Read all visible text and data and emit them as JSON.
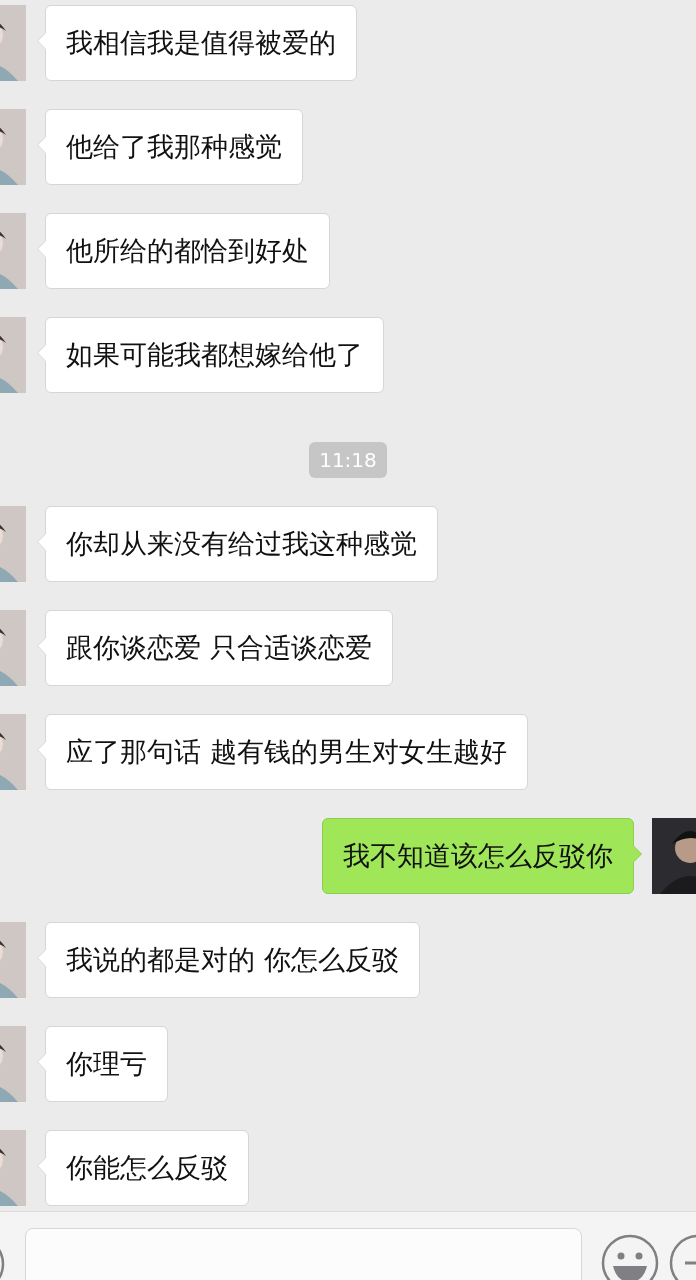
{
  "messages": [
    {
      "kind": "incoming",
      "text": "我相信我是值得被爱的"
    },
    {
      "kind": "incoming",
      "text": "他给了我那种感觉"
    },
    {
      "kind": "incoming",
      "text": "他所给的都恰到好处"
    },
    {
      "kind": "incoming",
      "text": "如果可能我都想嫁给他了"
    },
    {
      "kind": "time",
      "text": "11:18"
    },
    {
      "kind": "incoming",
      "text": "你却从来没有给过我这种感觉"
    },
    {
      "kind": "incoming",
      "text": "跟你谈恋爱 只合适谈恋爱"
    },
    {
      "kind": "incoming",
      "text": "应了那句话 越有钱的男生对女生越好"
    },
    {
      "kind": "outgoing",
      "text": "我不知道该怎么反驳你"
    },
    {
      "kind": "incoming",
      "text": "我说的都是对的 你怎么反驳"
    },
    {
      "kind": "incoming",
      "text": "你理亏"
    },
    {
      "kind": "incoming",
      "text": "你能怎么反驳"
    }
  ]
}
